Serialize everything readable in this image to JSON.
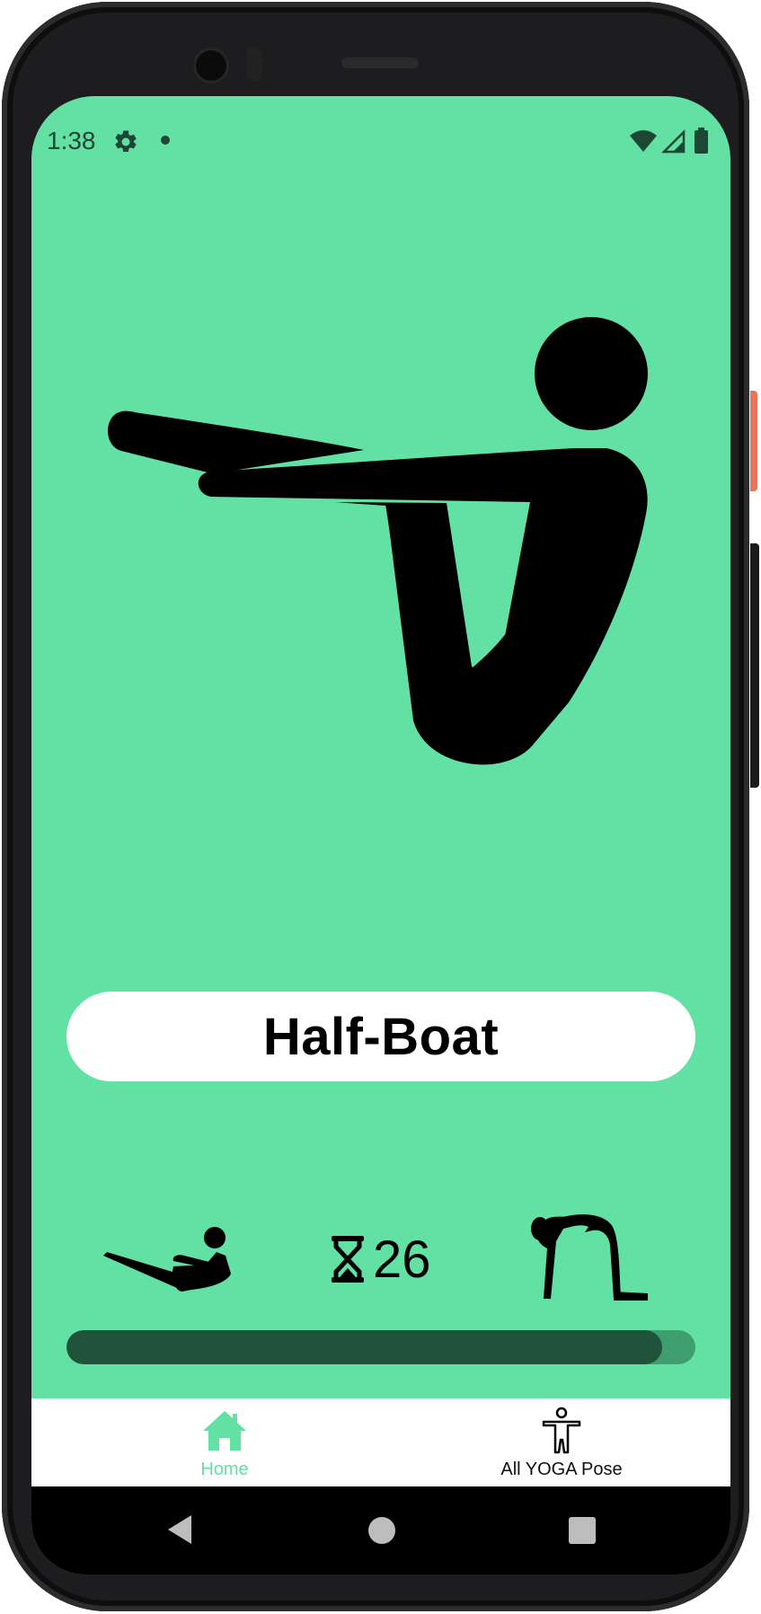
{
  "status_bar": {
    "time": "1:38",
    "icons": [
      "settings-icon",
      "notification-dot",
      "wifi-icon",
      "signal-icon",
      "battery-icon"
    ]
  },
  "pose": {
    "name": "Half-Boat",
    "image_icon": "half-boat-pose-figure"
  },
  "controls": {
    "previous_pose_icon": "previous-pose-icon",
    "timer_icon": "hourglass-icon",
    "timer_value": "26",
    "next_pose_icon": "next-pose-icon",
    "progress_fraction": 0.947
  },
  "bottom_nav": {
    "items": [
      {
        "label": "Home",
        "icon": "home-icon",
        "active": true
      },
      {
        "label": "All YOGA Pose",
        "icon": "person-icon",
        "active": false
      }
    ]
  },
  "colors": {
    "background": "#63e0a3",
    "progress_fill": "#21533a",
    "progress_track": "#3e9e70",
    "nav_active": "#63e0a3"
  }
}
